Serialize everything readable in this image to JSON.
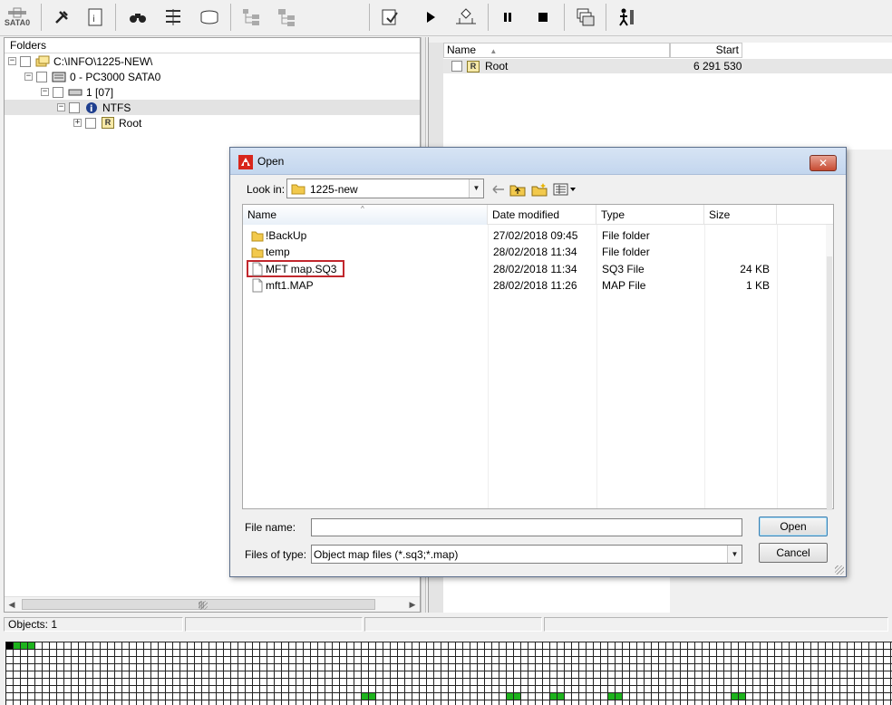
{
  "toolbar": {
    "sata_label": "SATA0",
    "buttons": [
      "sata-port-button",
      "tools-button",
      "report-button",
      "binoculars-button",
      "sort-button",
      "disk-button",
      "tree-button",
      "tree-alt-button",
      "export-button",
      "play-button",
      "branch-button",
      "pause-button",
      "stop-button",
      "windows-button",
      "run-button"
    ]
  },
  "folders": {
    "header": "Folders",
    "tree": [
      {
        "label": "C:\\INFO\\1225-NEW\\",
        "expander": "−",
        "icon": "folders-icon"
      },
      {
        "label": "0 - PC3000 SATA0",
        "expander": "−",
        "icon": "hdd-icon"
      },
      {
        "label": "1 [07]",
        "expander": "−",
        "icon": "partition-icon"
      },
      {
        "label": "NTFS",
        "expander": "−",
        "icon": "info-icon"
      },
      {
        "label": "Root",
        "expander": "+",
        "icon": "root-icon",
        "badge": "R"
      }
    ]
  },
  "list_pane": {
    "columns": {
      "name": "Name",
      "start": "Start"
    },
    "rows": [
      {
        "name": "Root",
        "badge": "R",
        "start": "6 291 530"
      }
    ]
  },
  "status": {
    "objects": "Objects: 1"
  },
  "sector_map": {
    "colors": {
      "used": "#1db31d",
      "current": "#000000",
      "empty": "#ffffff",
      "grid": "#222222"
    }
  },
  "dialog": {
    "title": "Open",
    "close_glyph": "✕",
    "look_in_label": "Look in:",
    "look_in_value": "1225-new",
    "columns": {
      "name": "Name",
      "date": "Date modified",
      "type": "Type",
      "size": "Size"
    },
    "files": [
      {
        "name": "!BackUp",
        "date": "27/02/2018 09:45",
        "type": "File folder",
        "size": "",
        "icon": "folder-icon"
      },
      {
        "name": "temp",
        "date": "28/02/2018 11:34",
        "type": "File folder",
        "size": "",
        "icon": "folder-icon"
      },
      {
        "name": "MFT map.SQ3",
        "date": "28/02/2018 11:34",
        "type": "SQ3 File",
        "size": "24 KB",
        "icon": "file-icon",
        "highlighted": true
      },
      {
        "name": "mft1.MAP",
        "date": "28/02/2018 11:26",
        "type": "MAP File",
        "size": "1 KB",
        "icon": "file-icon"
      }
    ],
    "file_name_label": "File name:",
    "file_name_value": "",
    "files_of_type_label": "Files of type:",
    "files_of_type_value": "Object map files (*.sq3;*.map)",
    "open_button": "Open",
    "cancel_button": "Cancel",
    "highlight_color": "#c1272d"
  }
}
